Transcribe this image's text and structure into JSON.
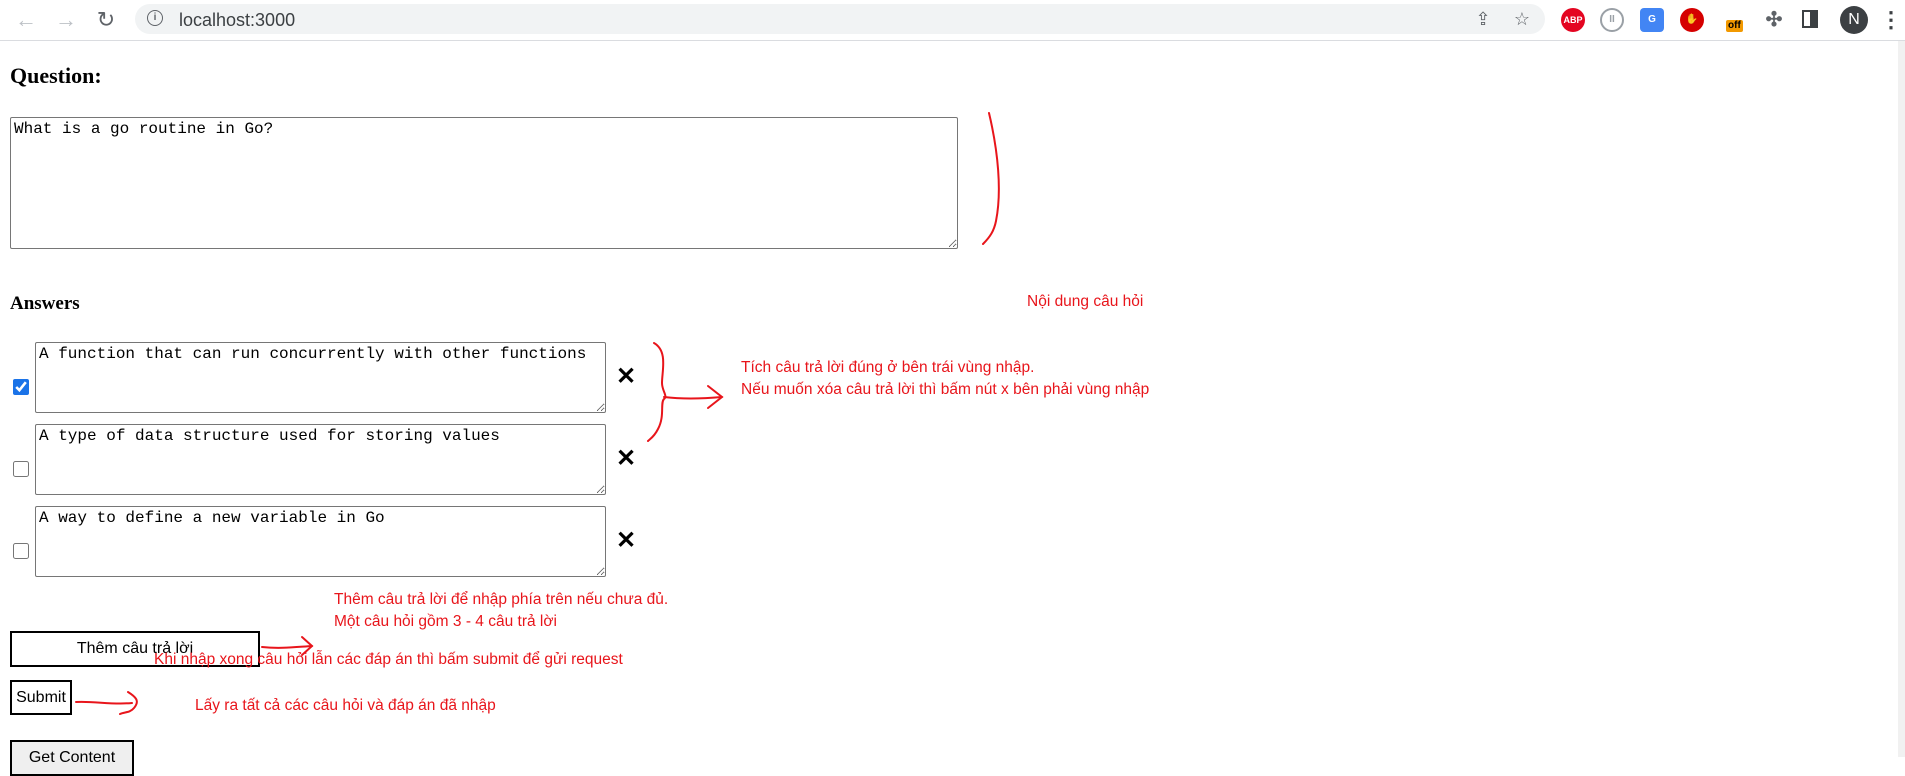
{
  "browser": {
    "url": "localhost:3000",
    "avatar_initial": "N",
    "extensions": [
      {
        "name": "adblock-plus",
        "label": "ABP"
      },
      {
        "name": "pause-extension",
        "label": "II"
      },
      {
        "name": "google-translate",
        "label": "G"
      },
      {
        "name": "stop-hand",
        "label": "✋"
      },
      {
        "name": "off-extension",
        "label": "off"
      }
    ]
  },
  "form": {
    "question_heading": "Question:",
    "question_text": "What is a go routine in Go?",
    "answers_heading": "Answers",
    "answers": [
      {
        "text": "A function that can run concurrently with other functions",
        "correct": true
      },
      {
        "text": "A type of data structure used for storing values",
        "correct": false
      },
      {
        "text": "A way to define a new variable in Go",
        "correct": false
      }
    ],
    "delete_symbol": "✕",
    "add_answer_label": "Thêm câu trả lời",
    "submit_label": "Submit",
    "get_content_label": "Get Content"
  },
  "annotations": {
    "question_note": "Nội dung câu hỏi",
    "answers_note_line1": "Tích câu trả lời đúng ở bên trái vùng nhập.",
    "answers_note_line2": "Nếu muốn xóa câu trả lời thì bấm nút x bên phải vùng nhập",
    "add_note_line1": "Thêm câu trả lời để nhập phía trên nếu chưa đủ.",
    "add_note_line2": "Một câu hỏi gồm 3 - 4 câu trả lời",
    "submit_note": "Khi nhập xong câu hỏi lẫn các đáp án thì bấm submit để gửi request",
    "get_note": "Lấy ra tất cả các câu hỏi và đáp án đã nhập",
    "color": "#e8151b"
  }
}
